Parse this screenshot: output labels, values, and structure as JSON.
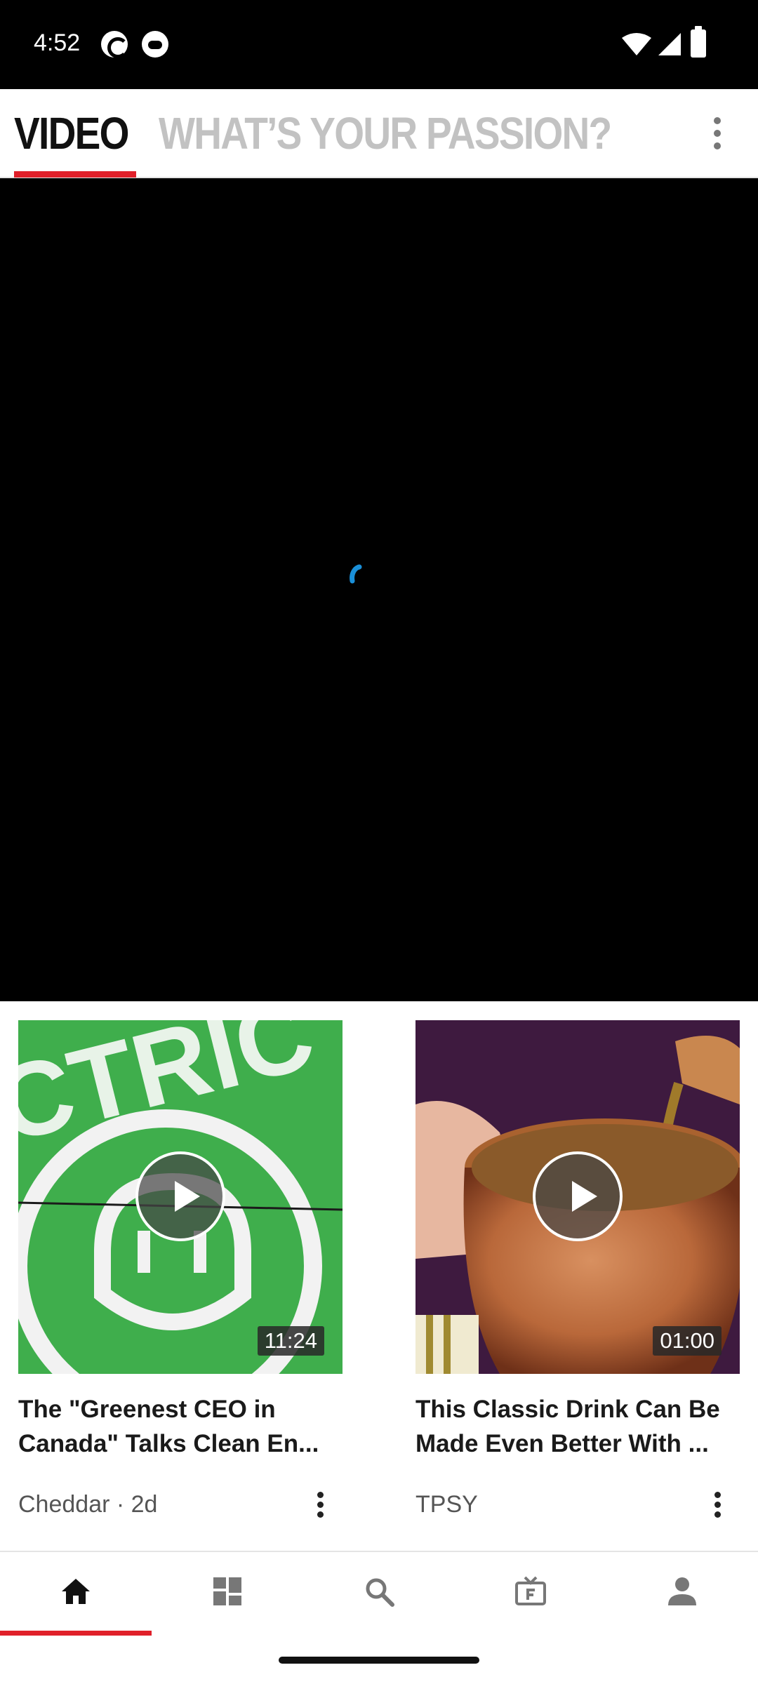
{
  "status_bar": {
    "time": "4:52"
  },
  "header": {
    "tabs": [
      {
        "label": "VIDEO",
        "active": true
      },
      {
        "label": "WHAT’S YOUR PASSION?",
        "active": false
      }
    ]
  },
  "player": {
    "state": "loading"
  },
  "videos": [
    {
      "title": "The \"Greenest CEO in Canada\" Talks Clean En...",
      "duration": "11:24",
      "source": "Cheddar · 2d"
    },
    {
      "title": "This Classic Drink Can Be Made Even Better With ...",
      "duration": "01:00",
      "source": "TPSY"
    }
  ],
  "bottom_nav": {
    "items": [
      "home-icon",
      "grid-icon",
      "search-icon",
      "tv-icon",
      "profile-icon"
    ],
    "active": "home-icon"
  },
  "colors": {
    "accent": "#e0202a",
    "spinner": "#1a8fd8",
    "inactive_tab": "#c2c2c2"
  }
}
